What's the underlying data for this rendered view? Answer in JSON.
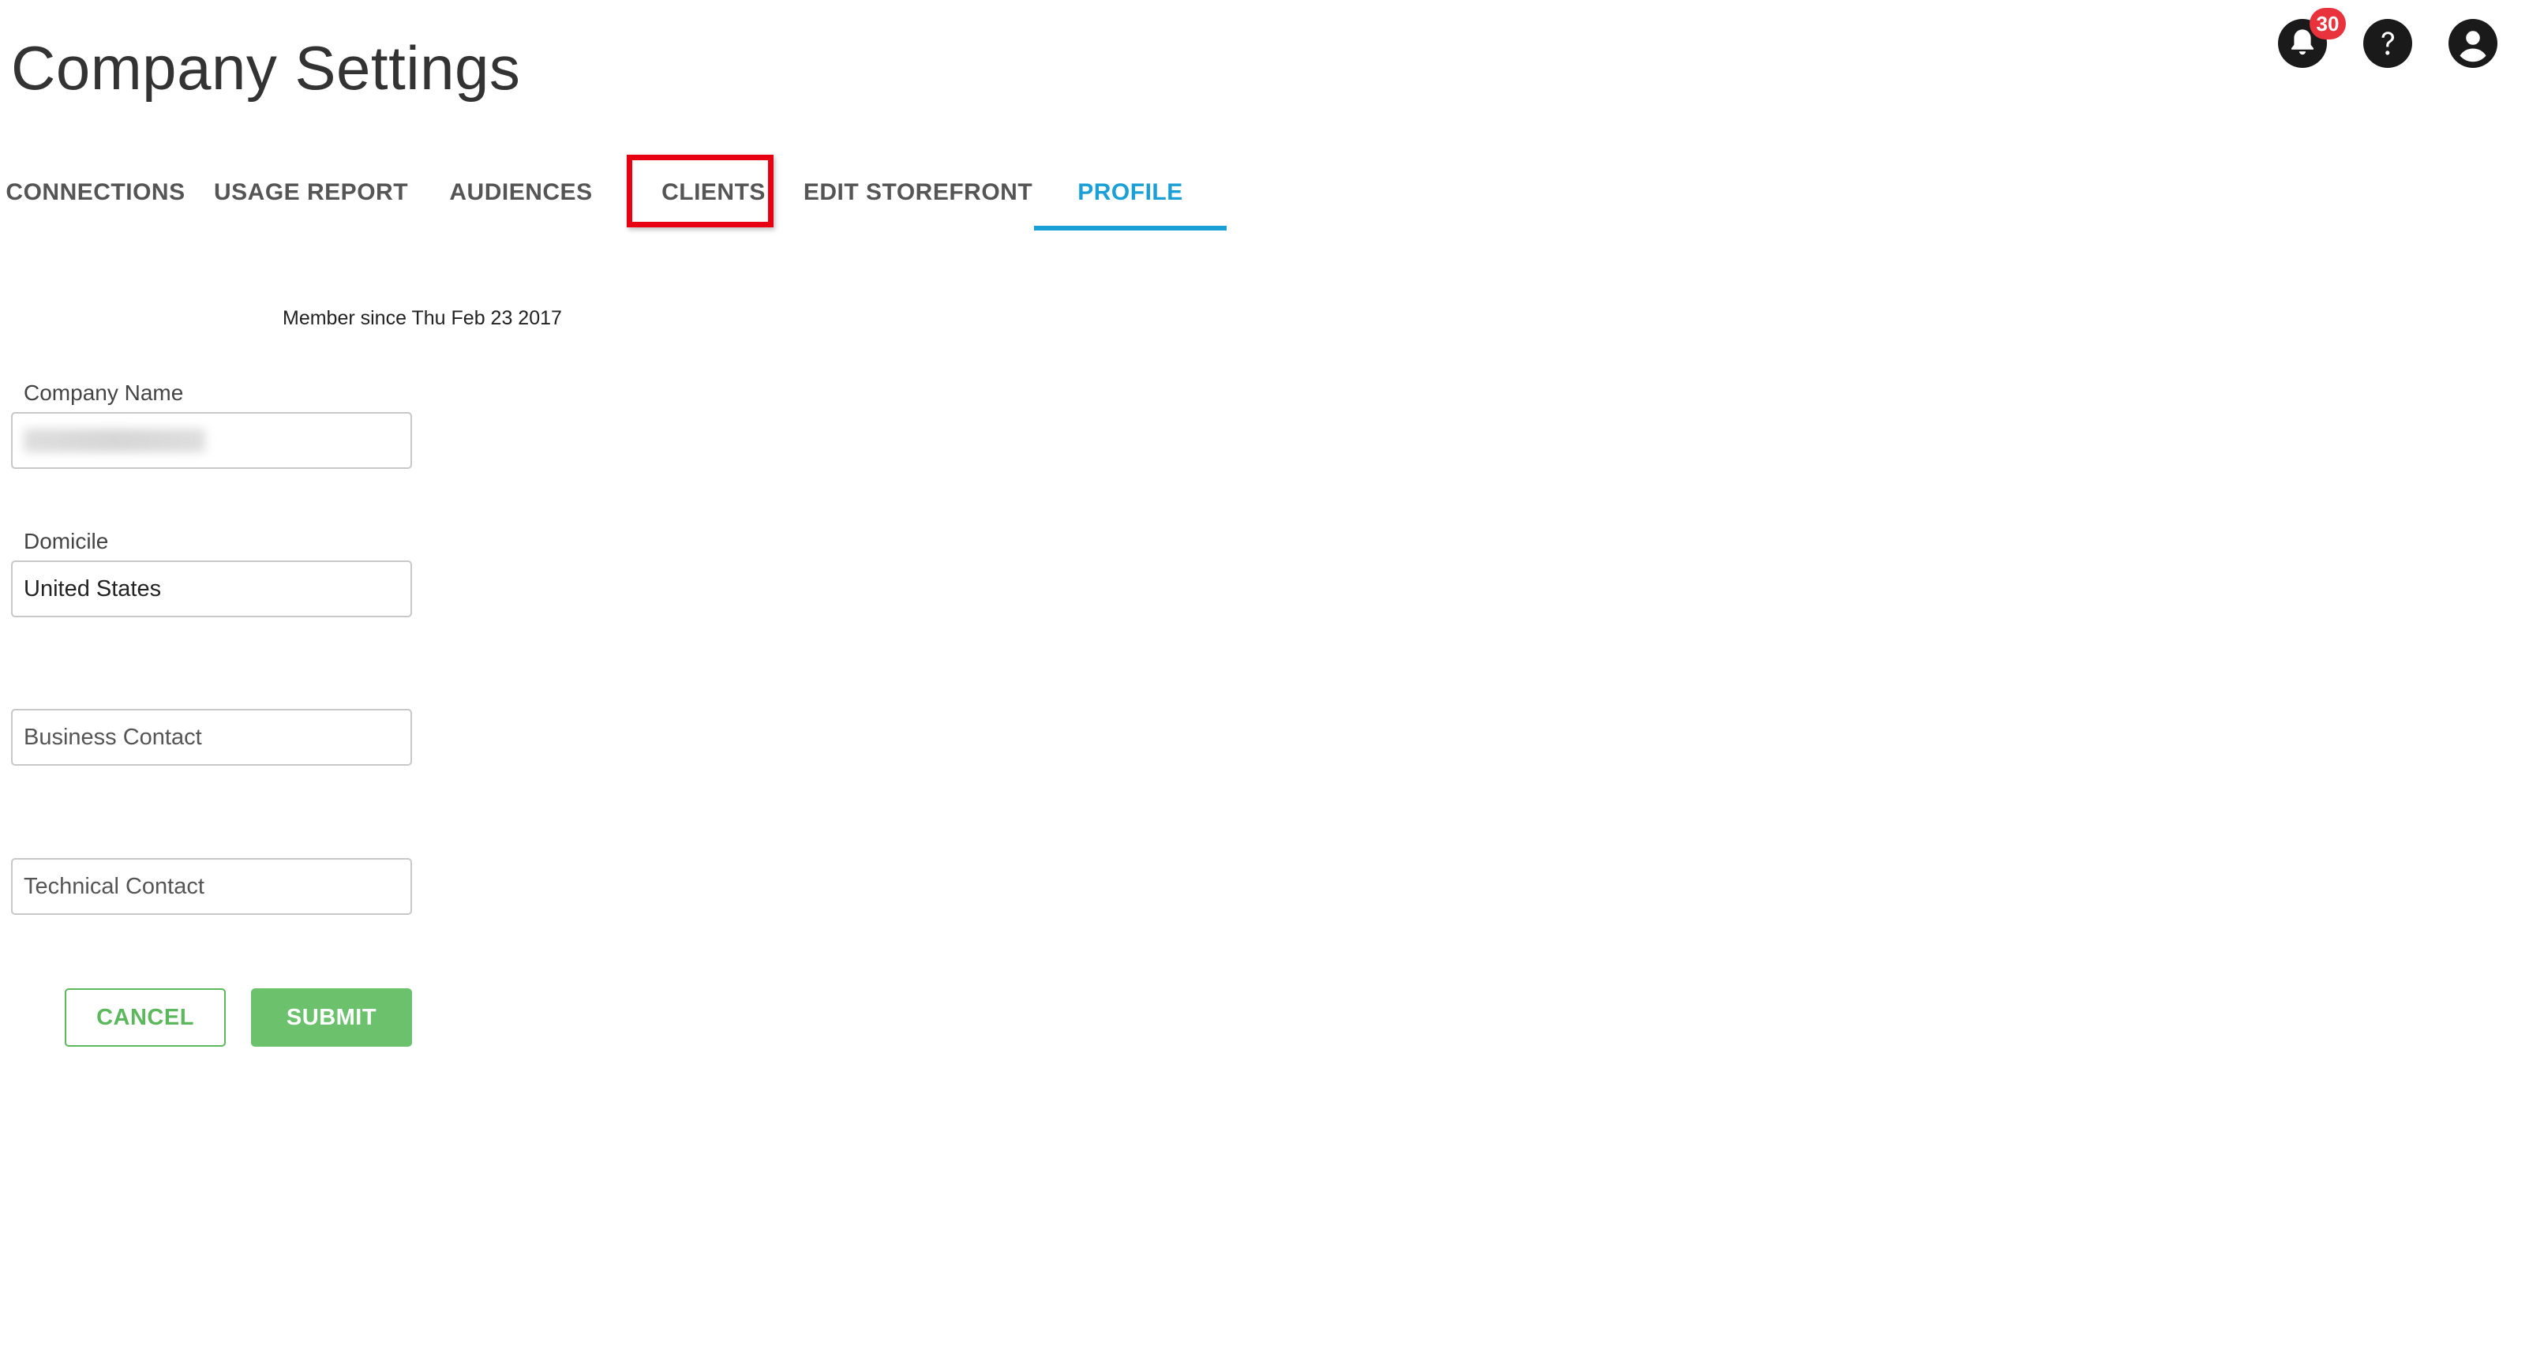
{
  "page": {
    "title": "Company Settings"
  },
  "header_icons": {
    "notifications": {
      "icon": "bell-icon",
      "badge_count": "30",
      "badge_color": "#e8323c"
    },
    "help": {
      "icon": "help-circle-icon"
    },
    "account": {
      "icon": "account-circle-icon"
    }
  },
  "tabs": [
    {
      "label": "CONNECTIONS",
      "active": false
    },
    {
      "label": "USAGE REPORT",
      "active": false
    },
    {
      "label": "AUDIENCES",
      "active": false
    },
    {
      "label": "CLIENTS",
      "active": false,
      "highlighted": true
    },
    {
      "label": "EDIT STOREFRONT",
      "active": false
    },
    {
      "label": "PROFILE",
      "active": true
    }
  ],
  "company": {
    "name": "",
    "member_since": "Member since Thu Feb 23 2017"
  },
  "form": {
    "company_name": {
      "label": "Company Name",
      "value": ""
    },
    "domicile": {
      "label": "Domicile",
      "value": "United States"
    },
    "business_contact": {
      "placeholder": "Business Contact",
      "value": ""
    },
    "technical_contact": {
      "placeholder": "Technical Contact",
      "value": ""
    }
  },
  "actions": {
    "cancel_label": "CANCEL",
    "submit_label": "SUBMIT"
  },
  "colors": {
    "accent": "#1a9fd6",
    "success": "#5cb85c",
    "highlight": "#e60012"
  }
}
